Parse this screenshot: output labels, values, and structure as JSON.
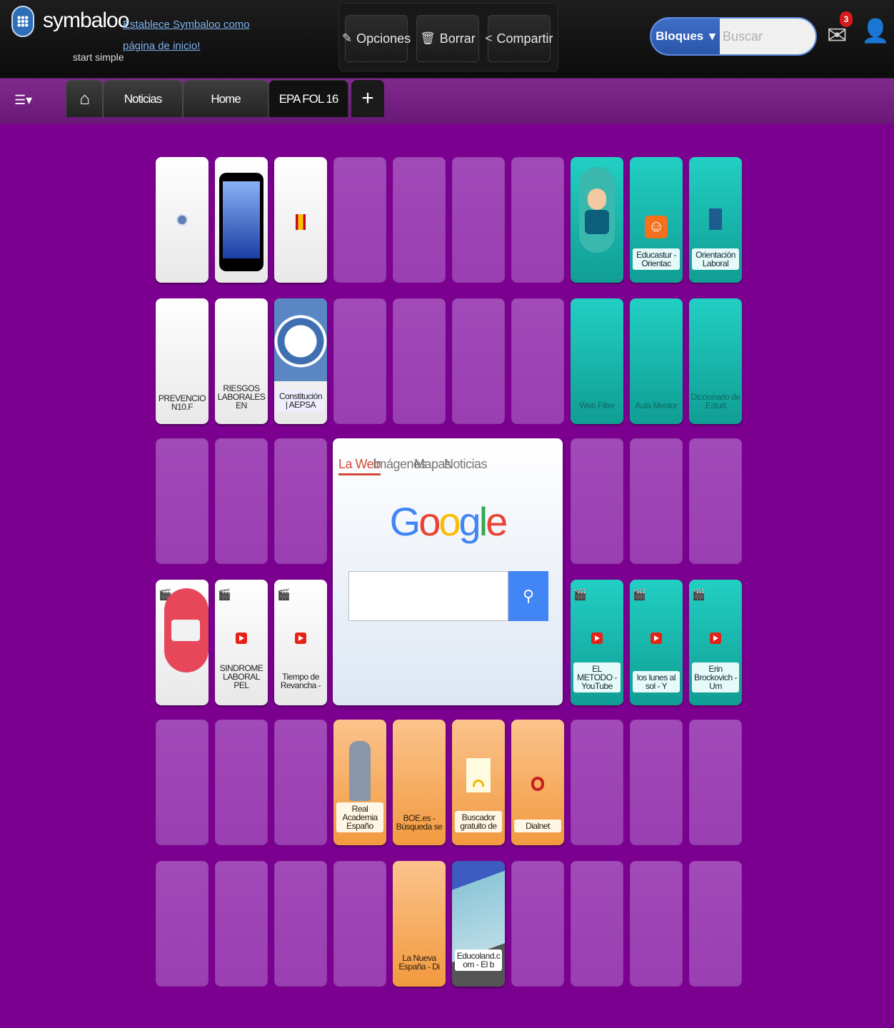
{
  "header": {
    "brand": "symbaloo",
    "tagline": "start simple",
    "set_home_link": "Establece Symbaloo como página de inicio!",
    "toolbar": {
      "options": "Opciones",
      "delete": "Borrar",
      "share": "Compartir"
    },
    "search": {
      "blocks_label": "Bloques",
      "placeholder": "Buscar"
    },
    "mail_badge": "3"
  },
  "tabs": [
    {
      "label": "Noticias"
    },
    {
      "label": "Home"
    },
    {
      "label": "EPA FOL 16"
    }
  ],
  "tiles": {
    "prevencion": "PREVENCION10.F",
    "riesgos": "RIESGOS LABORALES EN",
    "constitucion": "Constitución | AEPSA",
    "educastur": "Educastur - Orientac",
    "orientacion": "Orientación Laboral",
    "webfilter": "Web Filter",
    "aulamentor": "Aula Mentor",
    "diccionario": "Diccionario de Estud",
    "sindrome": "SINDROME LABORAL PEL",
    "tiempo": "Tiempo de Revancha -",
    "metodo": "EL METODO - YouTube",
    "lunes": "los lunes al sol - Y",
    "erin": "Erin Brockovich - Um",
    "rae": "Real Academia Españo",
    "boe": "BOE.es - Búsqueda se",
    "buscador": "Buscador gratuito de",
    "dialnet": "Dialnet",
    "nuevaespana": "La Nueva España - Di",
    "educoland": "Educoland.com - El b"
  },
  "google": {
    "tabs": [
      "La Web",
      "Imágenes",
      "Mapas",
      "Noticias"
    ],
    "logo": "Google"
  }
}
